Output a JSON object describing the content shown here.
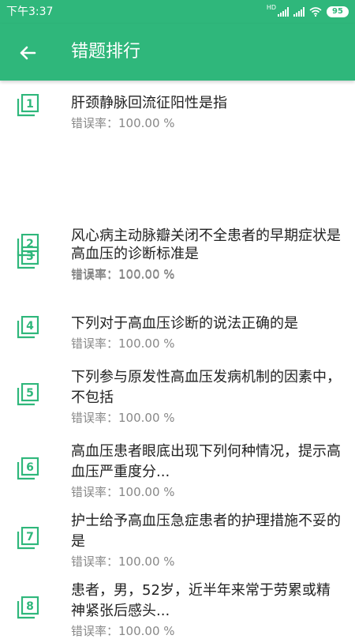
{
  "status_bar": {
    "time": "下午3:37",
    "network": "HD",
    "battery": "95"
  },
  "app_bar": {
    "title": "错题排行",
    "back_icon": "arrow-left-icon"
  },
  "colors": {
    "accent": "#2fb77b",
    "text_primary": "#222222",
    "text_secondary": "#888888"
  },
  "items": [
    {
      "rank": "1",
      "question": "肝颈静脉回流征阳性是指",
      "rate": "错误率：100.00 %"
    },
    {
      "rank": "2",
      "question": "风心病主动脉瓣关闭不全患者的早期症状是",
      "rate": "错误率：100.00 %"
    },
    {
      "rank": "3",
      "question": "高血压的诊断标准是",
      "rate": "错误率：100.00 %"
    },
    {
      "rank": "4",
      "question": "下列对于高血压诊断的说法正确的是",
      "rate": "错误率：100.00 %"
    },
    {
      "rank": "5",
      "question": "下列参与原发性高血压发病机制的因素中，不包括",
      "rate": "错误率：100.00 %"
    },
    {
      "rank": "6",
      "question": "高血压患者眼底出现下列何种情况，提示高血压严重度分...",
      "rate": "错误率：100.00 %"
    },
    {
      "rank": "7",
      "question": "护士给予高血压急症患者的护理措施不妥的是",
      "rate": "错误率：100.00 %"
    },
    {
      "rank": "8",
      "question": "患者，男，52岁，近半年来常于劳累或精神紧张后感头...",
      "rate": "错误率：100.00 %"
    }
  ]
}
